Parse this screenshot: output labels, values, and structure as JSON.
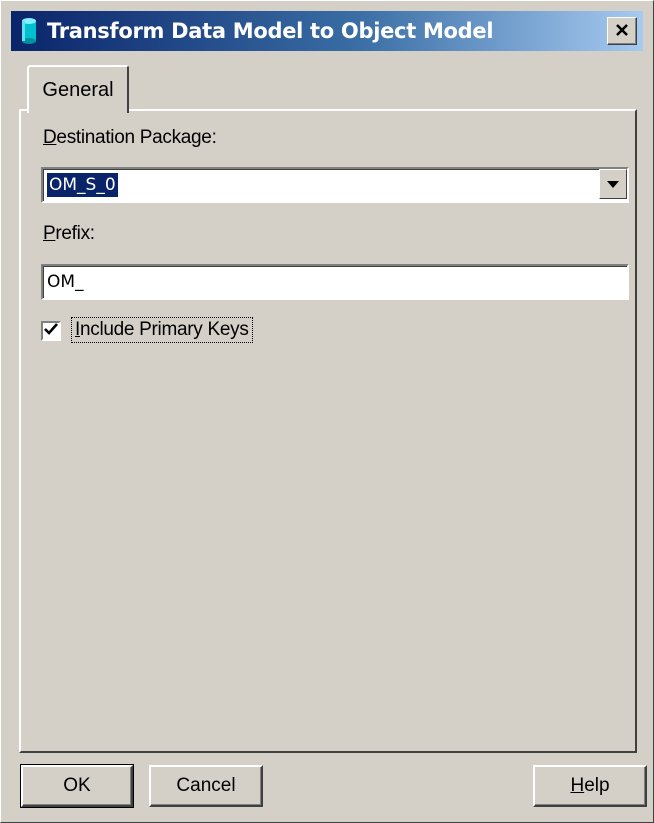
{
  "window": {
    "title": "Transform Data Model to Object Model",
    "close_glyph": "✕"
  },
  "tabs": [
    {
      "label": "General"
    }
  ],
  "form": {
    "destination_label_first": "D",
    "destination_label_rest": "estination Package:",
    "destination_value": "OM_S_0",
    "prefix_label_first": "P",
    "prefix_label_rest": "refix:",
    "prefix_value": "OM_",
    "include_pk_label_first": "I",
    "include_pk_label_rest": "nclude Primary Keys",
    "include_pk_checked": true
  },
  "buttons": {
    "ok": "OK",
    "cancel": "Cancel",
    "help_first": "H",
    "help_rest": "elp"
  },
  "icons": {
    "app": "database-cylinder-icon",
    "dropdown": "chevron-down-icon",
    "check": "checkmark-icon",
    "close": "close-icon"
  },
  "colors": {
    "titlebar_start": "#0a246a",
    "titlebar_end": "#a6caf0",
    "selection": "#0a246a",
    "face": "#d4d0c8"
  }
}
